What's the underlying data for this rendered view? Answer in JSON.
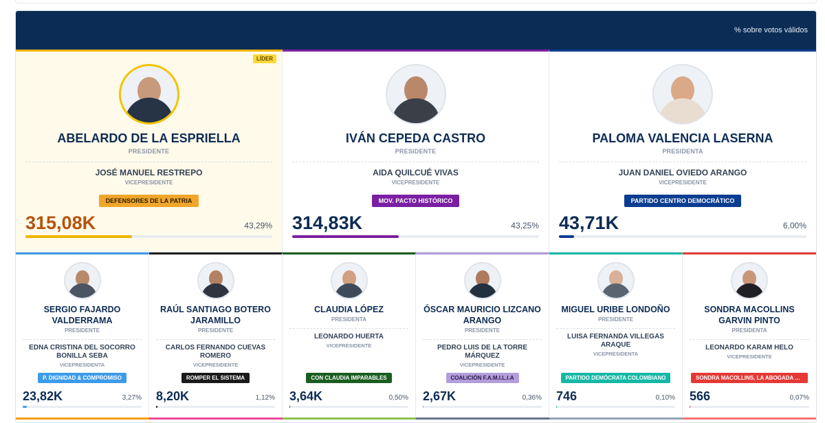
{
  "header": {
    "note": "% sobre votos válidos"
  },
  "leader_badge": "LÍDER",
  "main_candidates": [
    {
      "name": "ABELARDO DE LA ESPRIELLA",
      "role": "PRESIDENTE",
      "vp_name": "JOSÉ MANUEL RESTREPO",
      "vp_role": "VICEPRESIDENTE",
      "party": "DEFENSORES DE LA PATRIA",
      "party_color": "#f0a62a",
      "party_text_color": "#2c1d00",
      "votes": "315,08K",
      "votes_color": "#b5530f",
      "pct": "43,29%",
      "share": 0.4329,
      "accent": "#f0b400"
    },
    {
      "name": "IVÁN CEPEDA CASTRO",
      "role": "PRESIDENTE",
      "vp_name": "AIDA QUILCUÉ VIVAS",
      "vp_role": "VICEPRESIDENTE",
      "party": "MOV. PACTO HISTÓRICO",
      "party_color": "#7b1fa2",
      "party_text_color": "#ffffff",
      "votes": "314,83K",
      "votes_color": "#0d2c54",
      "pct": "43,25%",
      "share": 0.4325,
      "accent": "#7b1fa2"
    },
    {
      "name": "PALOMA VALENCIA LASERNA",
      "role": "PRESIDENTA",
      "vp_name": "JUAN DANIEL OVIEDO ARANGO",
      "vp_role": "VICEPRESIDENTE",
      "party": "PARTIDO CENTRO DEMOCRÁTICO",
      "party_color": "#0b3d91",
      "party_text_color": "#ffffff",
      "votes": "43,71K",
      "votes_color": "#0d2c54",
      "pct": "6,00%",
      "share": 0.06,
      "accent": "#0b3d91"
    }
  ],
  "other_candidates": [
    {
      "name": "SERGIO FAJARDO VALDERRAMA",
      "role": "PRESIDENTE",
      "vp_name": "EDNA CRISTINA DEL SOCORRO BONILLA SEBA",
      "vp_role": "VICEPRESIDENTA",
      "party": "P. DIGNIDAD & COMPROMISO",
      "party_color": "#3d9be9",
      "votes": "23,82K",
      "pct": "3,27%",
      "share": 0.0327,
      "accent": "#3d9be9"
    },
    {
      "name": "RAÚL SANTIAGO BOTERO JARAMILLO",
      "role": "PRESIDENTE",
      "vp_name": "CARLOS FERNANDO CUEVAS ROMERO",
      "vp_role": "VICEPRESIDENTE",
      "party": "ROMPER EL SISTEMA",
      "party_color": "#1a1a1a",
      "votes": "8,20K",
      "pct": "1,12%",
      "share": 0.0112,
      "accent": "#1a1a1a"
    },
    {
      "name": "CLAUDIA LÓPEZ",
      "role": "PRESIDENTA",
      "vp_name": "LEONARDO HUERTA",
      "vp_role": "VICEPRESIDENTE",
      "party": "CON CLAUDIA IMPARABLES",
      "party_color": "#1b5e20",
      "votes": "3,64K",
      "pct": "0,50%",
      "share": 0.005,
      "accent": "#1b5e20"
    },
    {
      "name": "ÓSCAR MAURICIO LIZCANO ARANGO",
      "role": "PRESIDENTE",
      "vp_name": "PEDRO LUIS DE LA TORRE MÁRQUEZ",
      "vp_role": "VICEPRESIDENTE",
      "party": "COALICIÓN F.A.M.I.L.I.A",
      "party_color": "#b39ddb",
      "party_text_color": "#2a1a4a",
      "votes": "2,67K",
      "pct": "0,36%",
      "share": 0.0036,
      "accent": "#b39ddb"
    },
    {
      "name": "MIGUEL URIBE LONDOÑO",
      "role": "PRESIDENTE",
      "vp_name": "LUISA FERNANDA VILLEGAS ARAQUE",
      "vp_role": "VICEPRESIDENTA",
      "party": "PARTIDO DEMÓCRATA COLOMBIANO",
      "party_color": "#14b8a6",
      "votes": "746",
      "pct": "0,10%",
      "share": 0.001,
      "accent": "#14b8a6"
    },
    {
      "name": "SONDRA MACOLLINS GARVIN PINTO",
      "role": "PRESIDENTA",
      "vp_name": "LEONARDO KARAM HELO",
      "vp_role": "VICEPRESIDENTE",
      "party": "SONDRA MACOLLINS, LA ABOGADA DE ...",
      "party_color": "#e53935",
      "votes": "566",
      "pct": "0,07%",
      "share": 0.0007,
      "accent": "#e53935"
    }
  ],
  "next_row_accents": [
    "#f59e0b",
    "#ec4899",
    "#8bc34a",
    "#64748b",
    "#94a3b8",
    "#f87171"
  ]
}
